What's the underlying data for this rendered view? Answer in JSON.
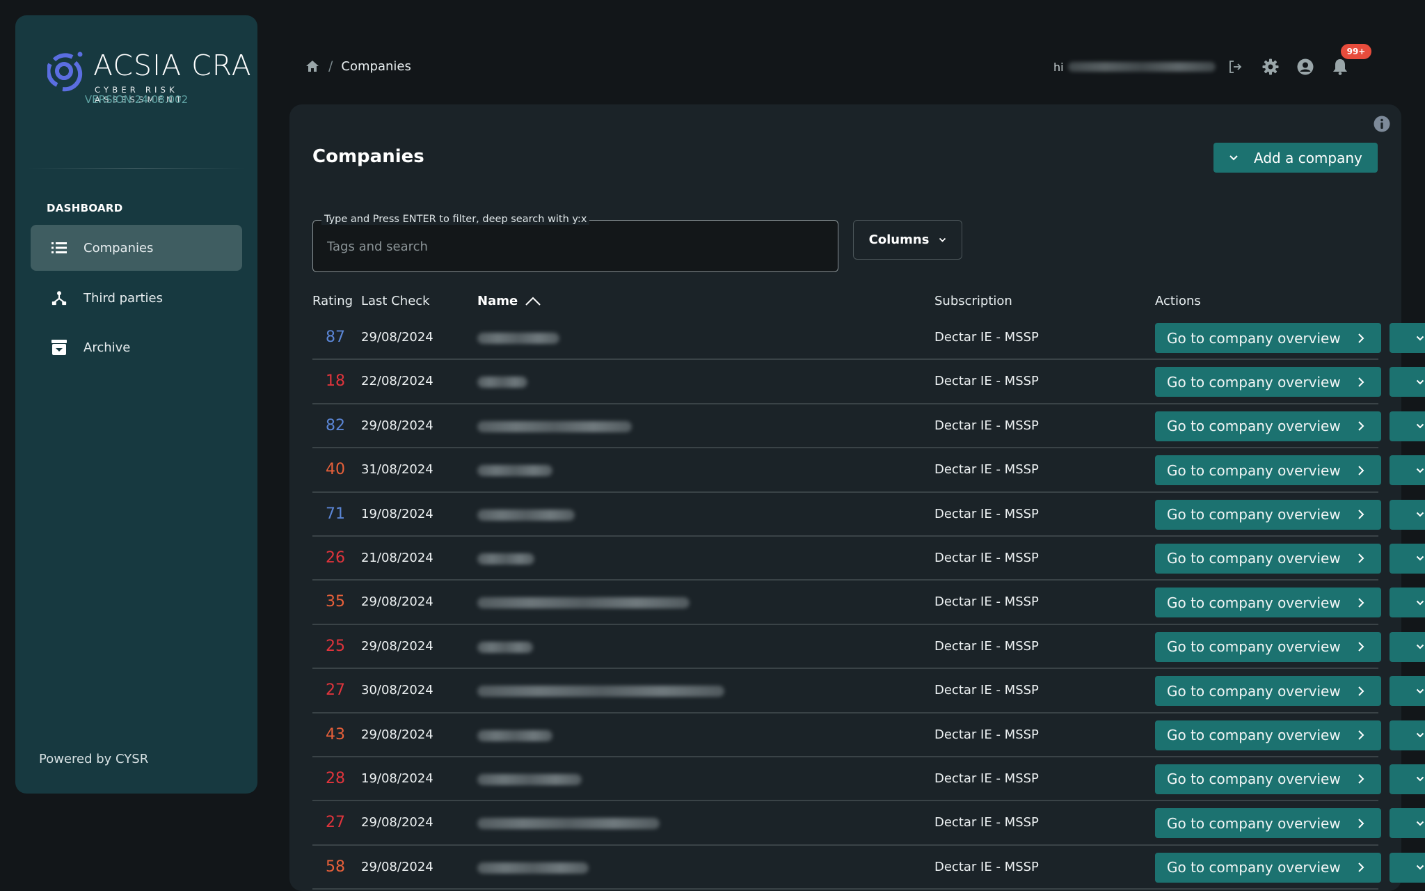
{
  "app": {
    "logo_title": "ACSIA CRA",
    "logo_subtitle": "CYBER RISK ASSESSMENT",
    "version": "VERSION 24.08.002",
    "brand_color": "#5b6ee1"
  },
  "sidebar": {
    "section_label": "DASHBOARD",
    "items": [
      {
        "label": "Companies",
        "icon": "list-icon",
        "active": true
      },
      {
        "label": "Third parties",
        "icon": "hierarchy-icon",
        "active": false
      },
      {
        "label": "Archive",
        "icon": "archive-icon",
        "active": false
      }
    ],
    "footer": "Powered by CYSR"
  },
  "header": {
    "breadcrumb": {
      "home_icon": "home-icon",
      "separator": "/",
      "current": "Companies"
    },
    "greeting": "hi",
    "icons": [
      "logout-icon",
      "gear-icon",
      "user-circle-icon",
      "bell-icon"
    ],
    "notification_badge": "99+"
  },
  "page": {
    "title": "Companies",
    "add_button": "Add a company",
    "search": {
      "label": "Type and Press ENTER to filter, deep search with y:x",
      "placeholder": "Tags and search",
      "value": ""
    },
    "columns_button": "Columns"
  },
  "table": {
    "headers": {
      "rating": "Rating",
      "last_check": "Last Check",
      "name": "Name",
      "subscription": "Subscription",
      "actions": "Actions"
    },
    "sort": {
      "column": "name",
      "direction": "ascending"
    },
    "action_label": "Go to company overview",
    "colors": {
      "good": "#5b86d6",
      "bad": "#e0343c",
      "medium": "#e8603a"
    },
    "rows": [
      {
        "rating": "87",
        "level": "good",
        "last_check": "29/08/2024",
        "subscription": "Dectar IE - MSSP",
        "name_redacted": true
      },
      {
        "rating": "18",
        "level": "bad",
        "last_check": "22/08/2024",
        "subscription": "Dectar IE - MSSP",
        "name_redacted": true
      },
      {
        "rating": "82",
        "level": "good",
        "last_check": "29/08/2024",
        "subscription": "Dectar IE - MSSP",
        "name_redacted": true
      },
      {
        "rating": "40",
        "level": "medium",
        "last_check": "31/08/2024",
        "subscription": "Dectar IE - MSSP",
        "name_redacted": true
      },
      {
        "rating": "71",
        "level": "good",
        "last_check": "19/08/2024",
        "subscription": "Dectar IE - MSSP",
        "name_redacted": true
      },
      {
        "rating": "26",
        "level": "bad",
        "last_check": "21/08/2024",
        "subscription": "Dectar IE - MSSP",
        "name_redacted": true
      },
      {
        "rating": "35",
        "level": "medium",
        "last_check": "29/08/2024",
        "subscription": "Dectar IE - MSSP",
        "name_redacted": true
      },
      {
        "rating": "25",
        "level": "bad",
        "last_check": "29/08/2024",
        "subscription": "Dectar IE - MSSP",
        "name_redacted": true
      },
      {
        "rating": "27",
        "level": "bad",
        "last_check": "30/08/2024",
        "subscription": "Dectar IE - MSSP",
        "name_redacted": true
      },
      {
        "rating": "43",
        "level": "medium",
        "last_check": "29/08/2024",
        "subscription": "Dectar IE - MSSP",
        "name_redacted": true
      },
      {
        "rating": "28",
        "level": "bad",
        "last_check": "19/08/2024",
        "subscription": "Dectar IE - MSSP",
        "name_redacted": true
      },
      {
        "rating": "27",
        "level": "bad",
        "last_check": "29/08/2024",
        "subscription": "Dectar IE - MSSP",
        "name_redacted": true
      },
      {
        "rating": "58",
        "level": "medium",
        "last_check": "29/08/2024",
        "subscription": "Dectar IE - MSSP",
        "name_redacted": true
      }
    ]
  }
}
